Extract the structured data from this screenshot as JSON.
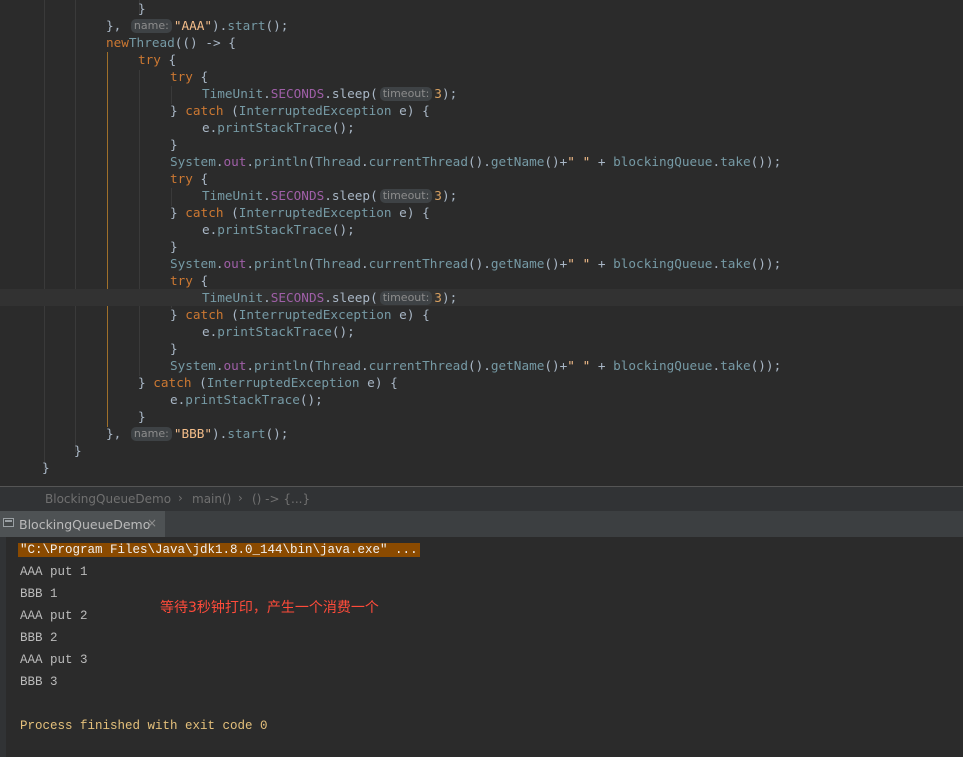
{
  "code": {
    "lines": [
      {
        "indent": 17,
        "text": "}"
      },
      {
        "indent": 13,
        "segments": [
          "}, ",
          "name:",
          "\"AAA\"",
          ").",
          "start",
          "();"
        ]
      },
      {
        "indent": 13,
        "segments": [
          "new",
          "Thread",
          "(() -> {"
        ]
      },
      {
        "indent": 17,
        "segments": [
          "try",
          " {"
        ]
      },
      {
        "indent": 21,
        "segments": [
          "try",
          " {"
        ]
      },
      {
        "indent": 25,
        "segments": [
          "TimeUnit",
          ".",
          "SECONDS",
          ".sleep(",
          "timeout:",
          "3",
          ");"
        ]
      },
      {
        "indent": 21,
        "segments": [
          "} ",
          "catch",
          " (",
          "InterruptedException",
          " e) {"
        ]
      },
      {
        "indent": 25,
        "segments": [
          "e.",
          "printStackTrace",
          "();"
        ]
      },
      {
        "indent": 21,
        "text": "}"
      },
      {
        "indent": 21,
        "segments": [
          "System",
          ".",
          "out",
          ".",
          "println",
          "(",
          "Thread",
          ".",
          "currentThread",
          "().",
          "getName",
          "()+",
          "\" \"",
          " + ",
          "blockingQueue",
          ".",
          "take",
          "());"
        ]
      },
      {
        "indent": 21,
        "segments": [
          "try",
          " {"
        ]
      },
      {
        "indent": 25,
        "segments": [
          "TimeUnit",
          ".",
          "SECONDS",
          ".sleep(",
          "timeout:",
          "3",
          ");"
        ]
      },
      {
        "indent": 21,
        "segments": [
          "} ",
          "catch",
          " (",
          "InterruptedException",
          " e) {"
        ]
      },
      {
        "indent": 25,
        "segments": [
          "e.",
          "printStackTrace",
          "();"
        ]
      },
      {
        "indent": 21,
        "text": "}"
      },
      {
        "indent": 21,
        "segments": [
          "System",
          ".",
          "out",
          ".",
          "println",
          "(",
          "Thread",
          ".",
          "currentThread",
          "().",
          "getName",
          "()+",
          "\" \"",
          " + ",
          "blockingQueue",
          ".",
          "take",
          "());"
        ]
      },
      {
        "indent": 21,
        "segments": [
          "try",
          " {"
        ]
      },
      {
        "indent": 25,
        "segments": [
          "TimeUnit",
          ".",
          "SECONDS",
          ".sleep(",
          "timeout:",
          "3",
          ");"
        ]
      },
      {
        "indent": 21,
        "segments": [
          "} ",
          "catch",
          " (",
          "InterruptedException",
          " e) {"
        ]
      },
      {
        "indent": 25,
        "segments": [
          "e.",
          "printStackTrace",
          "();"
        ]
      },
      {
        "indent": 21,
        "text": "}"
      },
      {
        "indent": 21,
        "segments": [
          "System",
          ".",
          "out",
          ".",
          "println",
          "(",
          "Thread",
          ".",
          "currentThread",
          "().",
          "getName",
          "()+",
          "\" \"",
          " + ",
          "blockingQueue",
          ".",
          "take",
          "());"
        ]
      },
      {
        "indent": 17,
        "segments": [
          "} ",
          "catch",
          " (",
          "InterruptedException",
          " e) {"
        ]
      },
      {
        "indent": 21,
        "segments": [
          "e.",
          "printStackTrace",
          "();"
        ]
      },
      {
        "indent": 17,
        "text": "}"
      },
      {
        "indent": 13,
        "segments": [
          "}, ",
          "name:",
          "\"BBB\"",
          ").",
          "start",
          "();"
        ]
      },
      {
        "indent": 9,
        "text": "}"
      },
      {
        "indent": 5,
        "text": "}"
      }
    ]
  },
  "breadcrumb": {
    "items": [
      "BlockingQueueDemo",
      "main()",
      "() -> {...}"
    ],
    "separator": "›"
  },
  "run_tab": {
    "label": "BlockingQueueDemo",
    "close": "×"
  },
  "console": {
    "command": "\"C:\\Program Files\\Java\\jdk1.8.0_144\\bin\\java.exe\" ...",
    "output": [
      "AAA put 1",
      "BBB 1",
      "AAA put 2",
      "BBB 2",
      "AAA put 3",
      "BBB 3"
    ],
    "finished": "Process finished with exit code 0",
    "annotation": "等待3秒钟打印，产生一个消费一个"
  },
  "colors": {
    "background": "#2b2b2b",
    "keyword": "#cc7832",
    "string": "#6a8759",
    "field": "#9876aa",
    "annotation": "#ff4b3a",
    "command_highlight": "#8a4a00"
  }
}
